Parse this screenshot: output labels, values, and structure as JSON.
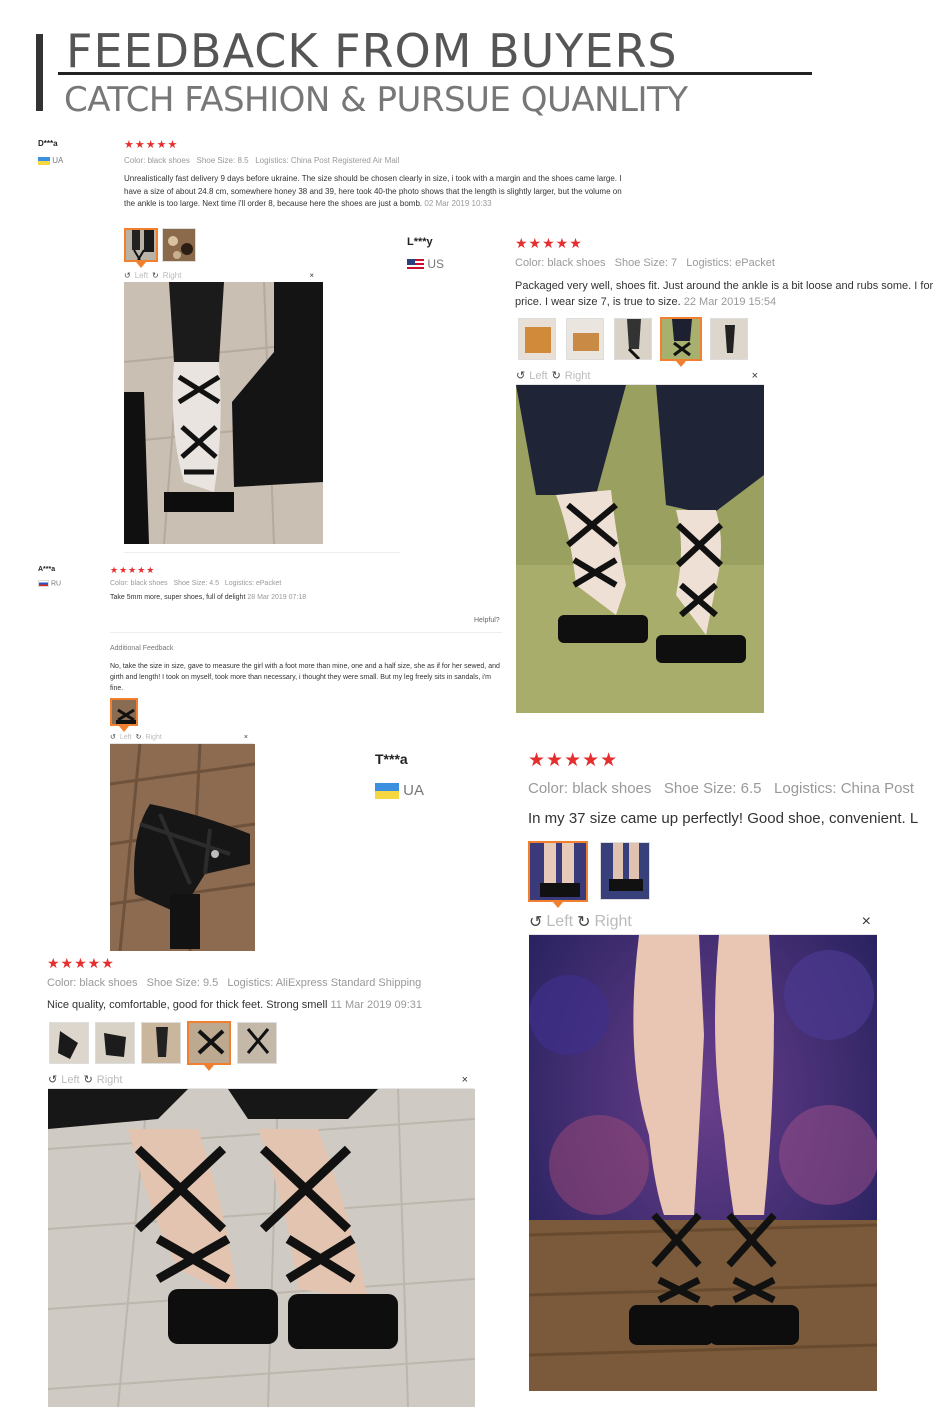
{
  "header": {
    "title": "FEEDBACK FROM BUYERS",
    "subtitle": "CATCH FASHION & PURSUE QUANLITY"
  },
  "ui": {
    "stars": "★★★★★",
    "left": "Left",
    "right": "Right",
    "close": "×",
    "rotate_left_icon": "↺",
    "rotate_right_icon": "↻",
    "helpful": "Helpful?",
    "additional_feedback": "Additional Feedback",
    "color_label": "Color:",
    "size_label": "Shoe Size:",
    "logistics_label": "Logistics:"
  },
  "reviews": [
    {
      "user": "D***a",
      "country": "UA",
      "color": "black shoes",
      "size": "8.5",
      "logistics": "China Post Registered Air Mail",
      "text": "Unrealistically fast delivery 9 days before ukraine. The size should be chosen clearly in size, i took with a margin and the shoes came large. I have a size of about 24.8 cm, somewhere honey 38 and 39, here took 40-the photo shows that the length is slightly larger, but the volume on the ankle is too large. Next time i'll order 8, because here the shoes are just a bomb.",
      "date": "02 Mar 2019 10:33"
    },
    {
      "user": "L***y",
      "country": "US",
      "color": "black shoes",
      "size": "7",
      "logistics": "ePacket",
      "text": "Packaged very well, shoes fit. Just around the ankle is a bit loose and rubs some. I for price. I wear size 7, is true to size.",
      "date": "22 Mar 2019 15:54"
    },
    {
      "user": "A***a",
      "country": "RU",
      "color": "black shoes",
      "size": "4.5",
      "logistics": "ePacket",
      "text": "Take 5mm more, super shoes, full of delight",
      "date": "28 Mar 2019 07:18",
      "additional": "No, take the size in size, gave to measure the girl with a foot more than mine, one and a half size, she as if for her sewed, and girth and length! I took on myself, took more than necessary, i thought they were small. But my leg freely sits in sandals, i'm fine."
    },
    {
      "user": "T***a",
      "country": "UA",
      "color": "black shoes",
      "size": "6.5",
      "logistics": "China Post",
      "text": "In my 37 size came up perfectly! Good shoe, convenient. L"
    },
    {
      "color": "black shoes",
      "size": "9.5",
      "logistics": "AliExpress Standard Shipping",
      "text": "Nice quality, comfortable, good for thick feet. Strong smell",
      "date": "11 Mar 2019 09:31"
    }
  ],
  "colors": {
    "star": "#e62e2e",
    "selected_thumb": "#f07f30",
    "shoe": "#151515"
  }
}
